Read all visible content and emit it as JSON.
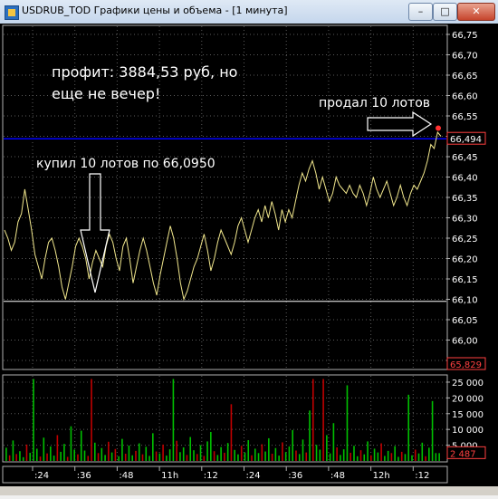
{
  "window": {
    "title": "USDRUB_TOD Графики цены и объема - [1 минута]",
    "minimize_label": "–",
    "maximize_label": "□",
    "close_label": "✕"
  },
  "annotations": {
    "profit_line1": "профит:  3884,53 руб, но",
    "profit_line2": "еще не вечер!",
    "sold": "продал 10 лотов",
    "bought": "купил 10 лотов по 66,0950"
  },
  "colors": {
    "background": "#000000",
    "grid": "#5a5a5a",
    "price_line": "#f0e68c",
    "current_price_line": "#0000ff",
    "volume_up": "#00c000",
    "volume_down": "#c00000",
    "scale_text": "#ffffff",
    "badge_text": "#ff4040"
  },
  "chart_data": [
    {
      "type": "line",
      "series": [
        {
          "values": [
            66.27,
            66.25,
            66.22,
            66.24,
            66.29,
            66.31,
            66.37,
            66.32,
            66.27,
            66.21,
            66.18,
            66.15,
            66.2,
            66.24,
            66.25,
            66.22,
            66.18,
            66.13,
            66.1,
            66.14,
            66.18,
            66.23,
            66.25,
            66.23,
            66.2,
            66.15,
            66.19,
            66.22,
            66.2,
            66.18,
            66.23,
            66.26,
            66.24,
            66.2,
            66.17,
            66.23,
            66.25,
            66.2,
            66.14,
            66.18,
            66.22,
            66.25,
            66.22,
            66.18,
            66.14,
            66.11,
            66.16,
            66.2,
            66.24,
            66.28,
            66.25,
            66.2,
            66.14,
            66.1,
            66.12,
            66.15,
            66.18,
            66.2,
            66.23,
            66.26,
            66.22,
            66.17,
            66.2,
            66.24,
            66.27,
            66.25,
            66.23,
            66.21,
            66.24,
            66.28,
            66.3,
            66.27,
            66.24,
            66.27,
            66.3,
            66.32,
            66.29,
            66.33,
            66.3,
            66.34,
            66.31,
            66.27,
            66.32,
            66.29,
            66.32,
            66.3,
            66.34,
            66.38,
            66.41,
            66.39,
            66.42,
            66.44,
            66.41,
            66.37,
            66.4,
            66.37,
            66.34,
            66.36,
            66.4,
            66.38,
            66.37,
            66.36,
            66.38,
            66.36,
            66.35,
            66.38,
            66.36,
            66.33,
            66.36,
            66.4,
            66.37,
            66.35,
            66.37,
            66.39,
            66.36,
            66.33,
            66.35,
            66.38,
            66.35,
            66.33,
            66.36,
            66.38,
            66.37,
            66.39,
            66.41,
            66.44,
            66.48,
            66.47,
            66.51,
            66.5
          ],
          "end_marker": 66.52
        }
      ],
      "ylim": [
        65.93,
        66.77
      ],
      "y_ticks": [
        "66,75",
        "66,70",
        "66,65",
        "66,60",
        "66,55",
        "66,50",
        "66,45",
        "66,40",
        "66,35",
        "66,30",
        "66,25",
        "66,20",
        "66,15",
        "66,10",
        "66,05",
        "66,00",
        "65,95"
      ],
      "y_tick_values": [
        66.75,
        66.7,
        66.65,
        66.6,
        66.55,
        66.5,
        66.45,
        66.4,
        66.35,
        66.3,
        66.25,
        66.2,
        66.15,
        66.1,
        66.05,
        66.0,
        65.95
      ],
      "current_price": 66.494,
      "current_price_label": "66,494",
      "buy_level": 66.095,
      "bottom_badge": "65,829",
      "x_ticks": [
        ":24",
        ":36",
        ":48",
        "11h",
        ":12",
        ":24",
        ":36",
        ":48",
        "12h",
        ":12"
      ],
      "grid": true
    },
    {
      "type": "bar",
      "ylim": [
        0,
        27000
      ],
      "y_ticks": [
        "25 000",
        "20 000",
        "15 000",
        "10 000",
        "5 000"
      ],
      "y_tick_values": [
        25000,
        20000,
        15000,
        10000,
        5000
      ],
      "last_value_label": "2 487",
      "values": [
        4200,
        1800,
        6500,
        2200,
        3100,
        1200,
        5200,
        2600,
        26000,
        3900,
        1400,
        7400,
        2400,
        4600,
        1700,
        8200,
        2900,
        5400,
        1300,
        11000,
        3600,
        2100,
        9600,
        3300,
        1600,
        26000,
        5800,
        2500,
        4100,
        1900,
        6100,
        2700,
        3800,
        1500,
        7000,
        2300,
        4900,
        1800,
        3200,
        5600,
        2100,
        4500,
        1600,
        8800,
        3000,
        2400,
        5200,
        1700,
        3700,
        26000,
        6400,
        2800,
        4300,
        1900,
        7600,
        3400,
        2200,
        5000,
        1600,
        6200,
        9200,
        3100,
        1900,
        4400,
        2600,
        5700,
        18000,
        3500,
        2100,
        4800,
        2700,
        6600,
        1800,
        3900,
        2500,
        5300,
        3000,
        7200,
        2300,
        4100,
        1700,
        5900,
        2800,
        4600,
        9800,
        3300,
        2200,
        6800,
        2700,
        16000,
        26000,
        5100,
        3600,
        26000,
        8200,
        2400,
        12000,
        4300,
        1900,
        3700,
        24000,
        2600,
        4800,
        1500,
        3400,
        2100,
        6200,
        1800,
        3900,
        2700,
        5600,
        1600,
        3200,
        2500,
        4700,
        1300,
        2900,
        2200,
        21000,
        1800,
        3600,
        2400,
        5800,
        1500,
        4200,
        19000,
        2500,
        2487
      ],
      "colors": [
        "u",
        "d",
        "u",
        "d",
        "u",
        "u",
        "d",
        "u",
        "u",
        "u",
        "d",
        "u",
        "d",
        "u",
        "u",
        "d",
        "u",
        "u",
        "d",
        "u",
        "u",
        "d",
        "u",
        "u",
        "d",
        "d",
        "u",
        "d",
        "u",
        "u",
        "d",
        "u",
        "d",
        "u",
        "u",
        "d",
        "u",
        "u",
        "d",
        "u",
        "d",
        "u",
        "u",
        "u",
        "d",
        "u",
        "d",
        "u",
        "u",
        "u",
        "d",
        "u",
        "u",
        "d",
        "u",
        "u",
        "d",
        "u",
        "d",
        "u",
        "u",
        "d",
        "u",
        "u",
        "d",
        "u",
        "d",
        "u",
        "u",
        "d",
        "u",
        "u",
        "d",
        "u",
        "u",
        "d",
        "u",
        "u",
        "d",
        "u",
        "u",
        "d",
        "u",
        "u",
        "u",
        "d",
        "u",
        "u",
        "d",
        "u",
        "d",
        "u",
        "u",
        "d",
        "u",
        "u",
        "u",
        "d",
        "u",
        "u",
        "u",
        "d",
        "u",
        "u",
        "d",
        "u",
        "u",
        "d",
        "u",
        "u",
        "d",
        "u",
        "u",
        "d",
        "u",
        "u",
        "d",
        "u",
        "u",
        "u",
        "d",
        "u",
        "u",
        "d",
        "u",
        "u",
        "u",
        "u"
      ]
    }
  ]
}
